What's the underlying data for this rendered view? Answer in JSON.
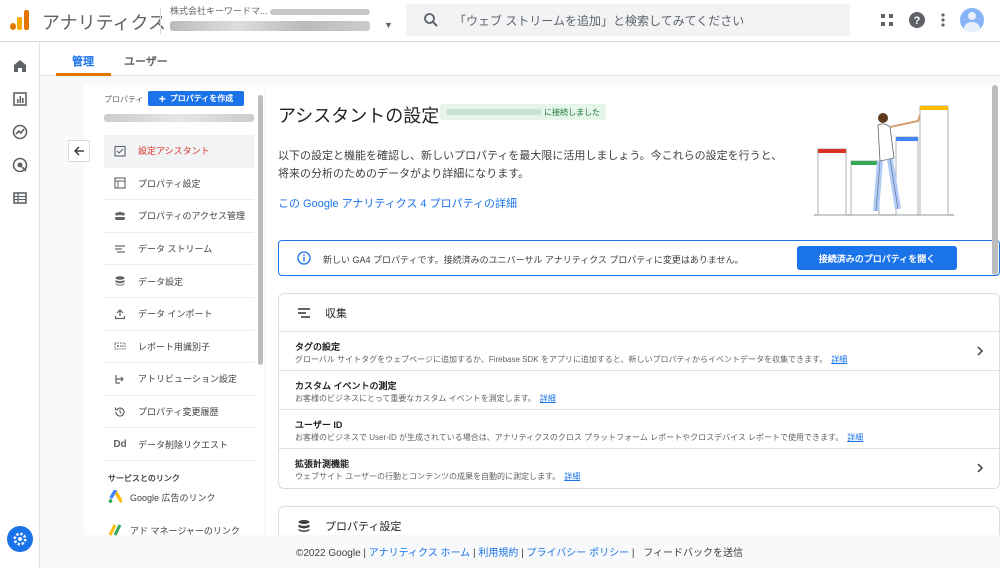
{
  "app": {
    "title": "アナリティクス"
  },
  "account": {
    "name_prefix": "株式会社キーワードマ..."
  },
  "search": {
    "placeholder": "「ウェブ ストリームを追加」と検索してみてください"
  },
  "tabs": [
    {
      "label": "管理"
    },
    {
      "label": "ユーザー"
    }
  ],
  "sidebar": {
    "property_label": "プロパティ",
    "create_button": "プロパティを作成",
    "items": [
      {
        "label": "設定アシスタント",
        "icon": "checklist-icon"
      },
      {
        "label": "プロパティ設定",
        "icon": "property-settings-icon"
      },
      {
        "label": "プロパティのアクセス管理",
        "icon": "people-icon"
      },
      {
        "label": "データ ストリーム",
        "icon": "stream-icon"
      },
      {
        "label": "データ設定",
        "icon": "database-icon"
      },
      {
        "label": "データ インポート",
        "icon": "upload-icon"
      },
      {
        "label": "レポート用識別子",
        "icon": "identifier-icon"
      },
      {
        "label": "アトリビューション設定",
        "icon": "attribution-icon"
      },
      {
        "label": "プロパティ変更履歴",
        "icon": "history-icon"
      },
      {
        "label": "データ削除リクエスト",
        "icon": "dd-icon"
      }
    ],
    "links_heading": "サービスとのリンク",
    "links": [
      {
        "label": "Google 広告のリンク"
      },
      {
        "label": "アド マネージャーのリンク"
      }
    ]
  },
  "main": {
    "title": "アシスタントの設定",
    "connected_suffix": "に接続しました",
    "intro_line1": "以下の設定と機能を確認し、新しいプロパティを最大限に活用しましょう。今これらの設定を行うと、",
    "intro_line2": "将来の分析のためのデータがより詳細になります。",
    "detail_link": "この Google アナリティクス 4 プロパティの詳細",
    "info_text": "新しい GA4 プロパティです。接続済みのユニバーサル アナリティクス プロパティに変更はありません。",
    "open_button": "接続済みのプロパティを開く",
    "collection": {
      "heading": "収集",
      "rows": [
        {
          "title": "タグの設定",
          "desc": "グローバル サイトタグをウェブページに追加するか、Firebase SDK をアプリに追加すると、新しいプロパティからイベントデータを収集できます。",
          "link": "詳細"
        },
        {
          "title": "カスタム イベントの測定",
          "desc": "お客様のビジネスにとって重要なカスタム イベントを測定します。",
          "link": "詳細"
        },
        {
          "title": "ユーザー ID",
          "desc": "お客様のビジネスで User-ID が生成されている場合は、アナリティクスのクロス プラットフォーム レポートやクロスデバイス レポートで使用できます。",
          "link": "詳細"
        },
        {
          "title": "拡張計測機能",
          "desc": "ウェブサイト ユーザーの行動とコンテンツの成果を自動的に測定します。",
          "link": "詳細"
        }
      ]
    },
    "property_settings_heading": "プロパティ設定"
  },
  "footer": {
    "copyright": "©2022 Google",
    "links": [
      "アナリティクス ホーム",
      "利用規約",
      "プライバシー ポリシー"
    ],
    "feedback": "フィードバックを送信"
  },
  "colors": {
    "accent": "#1a73e8",
    "tab_underline": "#e37400",
    "active_item": "#d93025"
  }
}
